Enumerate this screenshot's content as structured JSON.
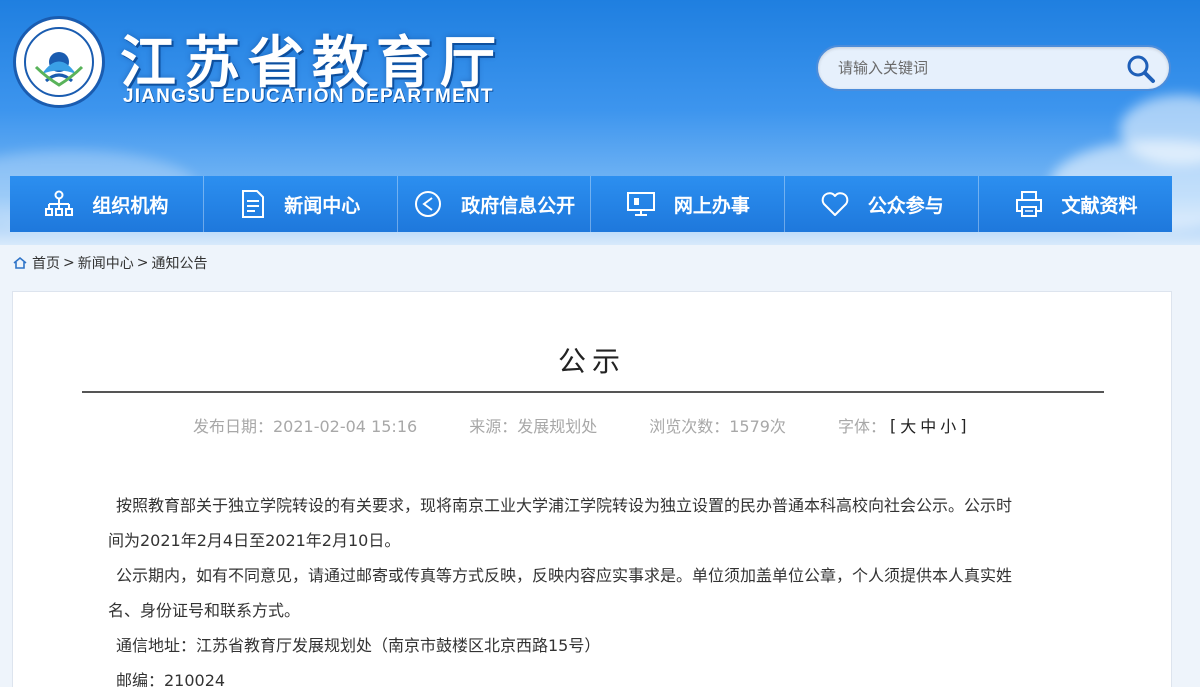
{
  "site": {
    "title_cn": "江苏省教育厅",
    "title_en": "JIANGSU EDUCATION DEPARTMENT"
  },
  "search": {
    "placeholder": "请输入关键词",
    "icon": "search-icon"
  },
  "nav": {
    "items": [
      {
        "label": "组织机构",
        "icon": "org-chart-icon"
      },
      {
        "label": "新闻中心",
        "icon": "document-icon"
      },
      {
        "label": "政府信息公开",
        "icon": "info-share-icon"
      },
      {
        "label": "网上办事",
        "icon": "monitor-icon"
      },
      {
        "label": "公众参与",
        "icon": "heart-icon"
      },
      {
        "label": "文献资料",
        "icon": "printer-icon"
      }
    ]
  },
  "breadcrumb": {
    "home": "首页",
    "sep": ">",
    "level1": "新闻中心",
    "level2": "通知公告"
  },
  "article": {
    "title": "公示",
    "publish_date": "发布日期：2021-02-04 15:16",
    "source": "来源：发展规划处",
    "views": "浏览次数：1579次",
    "font_label": "字体：",
    "font_large": "大",
    "font_medium": "中",
    "font_small": "小",
    "para1_line1": "按照教育部关于独立学院转设的有关要求，现将南京工业大学浦江学院转设为独立设置的民办普通本科高校向社会公示。公示时",
    "para1_line2": "间为2021年2月4日至2021年2月10日。",
    "para2_line1": "公示期内，如有不同意见，请通过邮寄或传真等方式反映，反映内容应实事求是。单位须加盖单位公章，个人须提供本人真实姓",
    "para2_line2": "名、身份证号和联系方式。",
    "address": "通信地址：江苏省教育厅发展规划处（南京市鼓楼区北京西路15号）",
    "postcode": "邮编：210024"
  }
}
